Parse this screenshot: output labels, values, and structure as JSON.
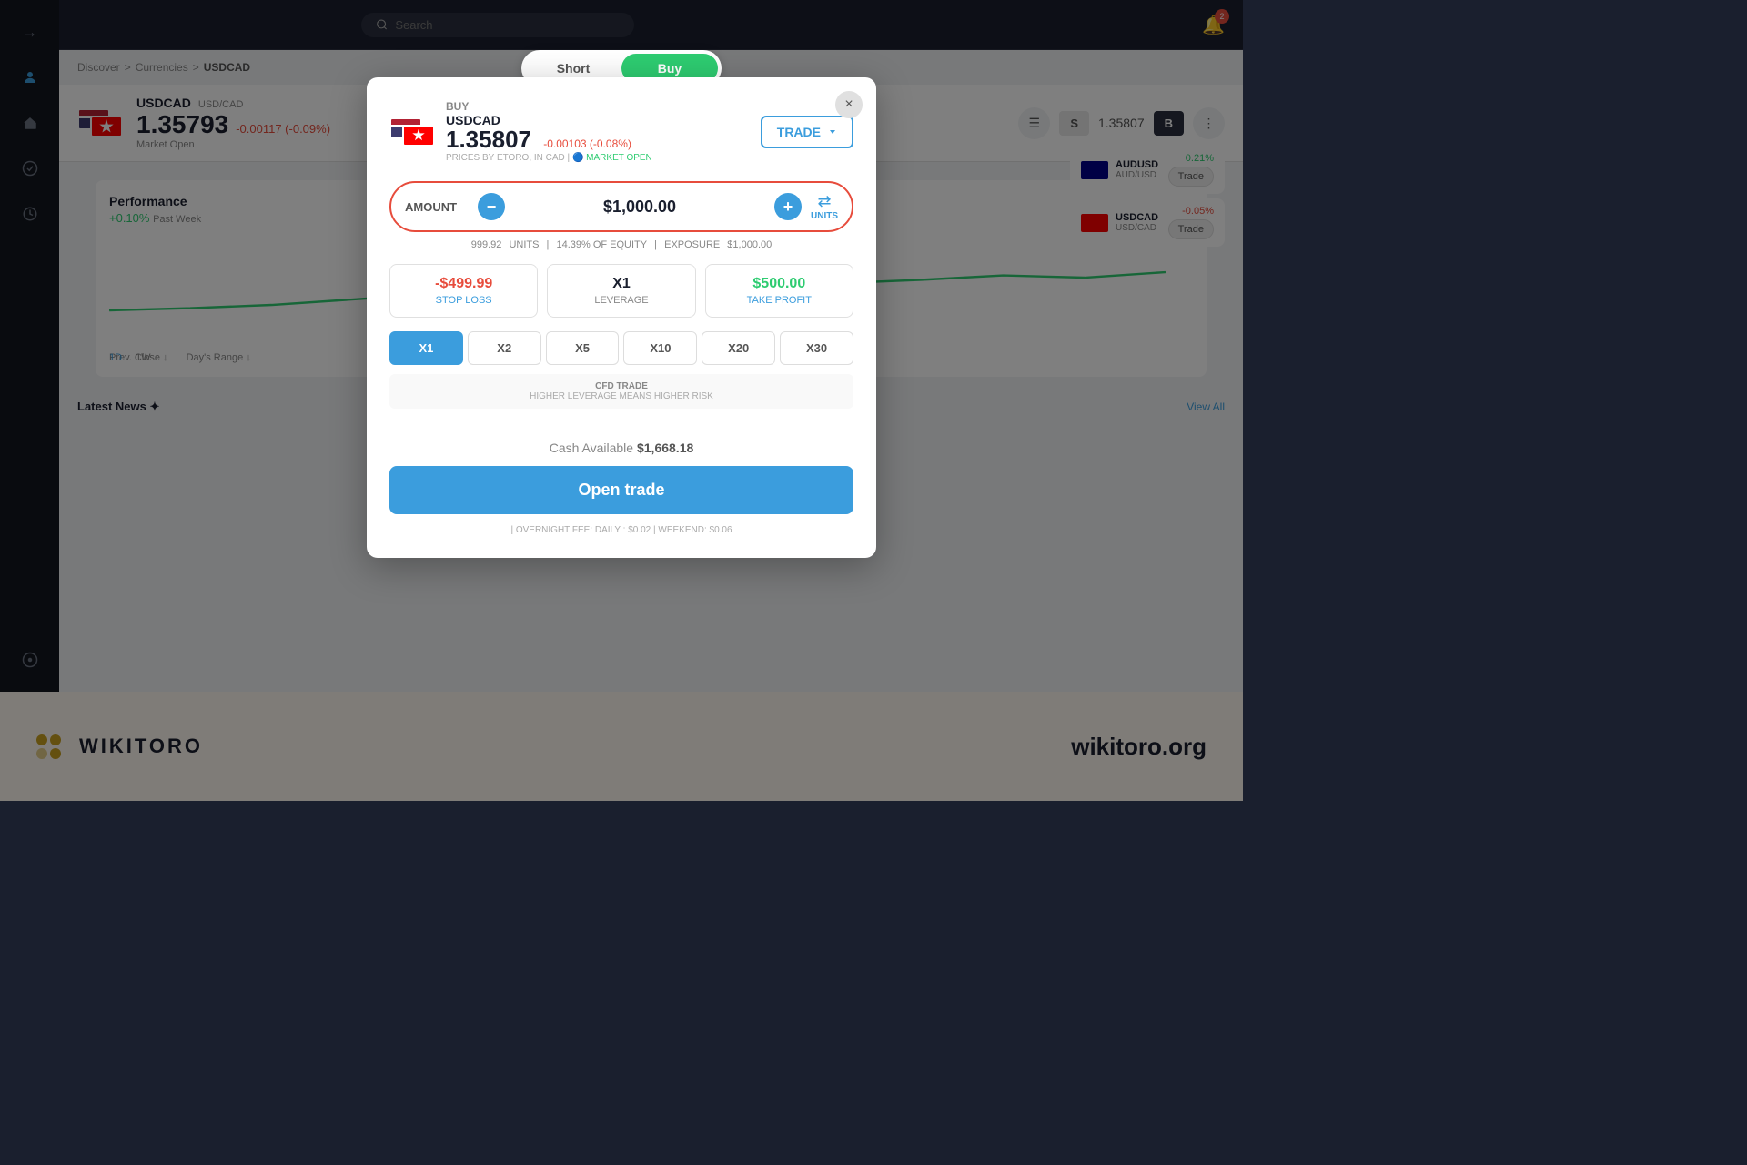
{
  "sidebar": {
    "icons": [
      "→",
      "👤",
      "🏠",
      "📊",
      "🔔",
      "🔄",
      "⚙️"
    ]
  },
  "topnav": {
    "search_placeholder": "Search",
    "notification_count": "2"
  },
  "breadcrumb": {
    "items": [
      "Discover",
      "Currencies",
      "USDCAD"
    ]
  },
  "asset": {
    "pair": "USDCAD",
    "subtitle": "USD/CAD",
    "price": "1.35793",
    "change": "-0.00117 (-0.09%)",
    "market_status": "Market Open",
    "currency": "IN CAD",
    "s_label": "S",
    "b_label": "B",
    "price_display": "1.35807"
  },
  "performance": {
    "title": "Performance",
    "value": "+0.10%",
    "period": "Past Week"
  },
  "modal": {
    "short_tab": "Short",
    "buy_tab": "Buy",
    "close_icon": "×",
    "buy_label": "BUY",
    "asset_name": "USDCAD",
    "price": "1.35807",
    "price_change": "-0.00103 (-0.08%)",
    "prices_by": "PRICES BY ETORO, IN CAD",
    "market_open": "MARKET OPEN",
    "trade_btn": "TRADE",
    "amount_label": "AMOUNT",
    "amount_minus": "−",
    "amount_plus": "+",
    "amount_value": "$1,000.00",
    "units_label": "UNITS",
    "units_count": "999.92",
    "equity_pct": "14.39% OF EQUITY",
    "exposure": "$1,000.00",
    "stop_loss_value": "-$499.99",
    "stop_loss_label": "STOP LOSS",
    "leverage_value": "X1",
    "leverage_label": "LEVERAGE",
    "take_profit_value": "$500.00",
    "take_profit_label": "TAKE PROFIT",
    "leverage_options": [
      "X1",
      "X2",
      "X5",
      "X10",
      "X20",
      "X30"
    ],
    "cfd_title": "CFD TRADE",
    "cfd_note": "HIGHER LEVERAGE MEANS HIGHER RISK",
    "cash_label": "Cash Available",
    "cash_amount": "$1,668.18",
    "open_trade_btn": "Open trade",
    "overnight_label": "OVERNIGHT FEE",
    "overnight_daily": "DAILY : $0.02",
    "overnight_weekend": "WEEKEND: $0.06"
  },
  "right_panel": {
    "items": [
      {
        "name": "AUDUSD",
        "sub": "AUD/USD",
        "change": "0.21%",
        "type": "pos"
      },
      {
        "name": "USDCAD",
        "sub": "USD/CAD",
        "change": "-0.05%",
        "type": "neg"
      }
    ]
  },
  "bottom": {
    "logo_icon": "✦✦✦",
    "logo_text": "WIKITORO",
    "url": "wikitoro.org"
  }
}
